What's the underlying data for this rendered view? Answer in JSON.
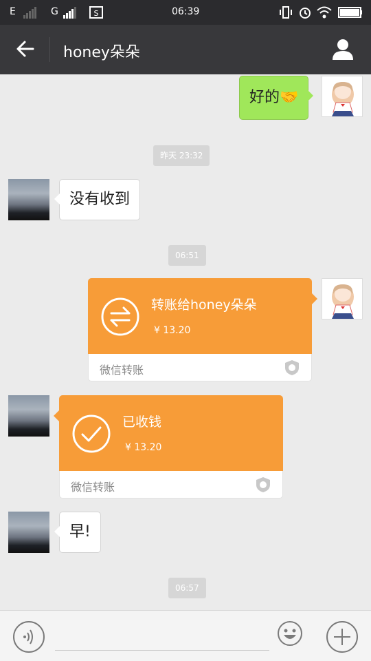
{
  "status_bar": {
    "network_e": "E",
    "network_g": "G",
    "time": "06:39"
  },
  "header": {
    "title": "honey朵朵"
  },
  "messages": {
    "m1_text": "好的🤝",
    "ts1": "昨天 23:32",
    "m2_text": "没有收到",
    "ts2": "06:51",
    "transfer_sent": {
      "title": "转账给honey朵朵",
      "amount": "¥ 13.20",
      "footer": "微信转账"
    },
    "transfer_received": {
      "title": "已收钱",
      "amount": "¥ 13.20",
      "footer": "微信转账"
    },
    "m3_text": "早!",
    "ts3": "06:57"
  },
  "input_bar": {
    "value": ""
  },
  "colors": {
    "navbar": "#38383b",
    "statusbar": "#2b2b2e",
    "transfer": "#f79c38",
    "sent_bubble": "#a0e75a",
    "background": "#ebebeb"
  }
}
